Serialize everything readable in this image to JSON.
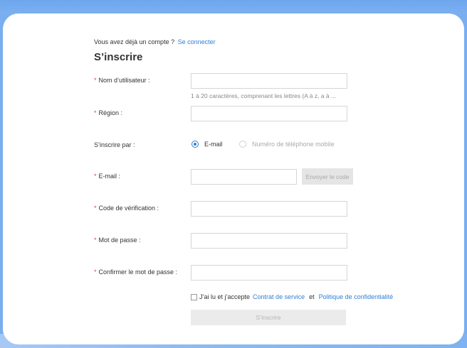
{
  "header": {
    "have_account_text": "Vous avez déjà un compte ?",
    "login_link": "Se connecter",
    "title": "S’inscrire"
  },
  "form": {
    "required_mark": "*",
    "username": {
      "label": "Nom d’utilisateur :",
      "value": "",
      "hint": "1 à 20 caractères, comprenant les lettres (A à z, a à ..."
    },
    "region": {
      "label": "Région :",
      "value": ""
    },
    "register_via": {
      "label": "S’inscrire par :",
      "options": [
        {
          "label": "E-mail",
          "selected": true
        },
        {
          "label": "Numéro de téléphone mobile",
          "selected": false,
          "disabled": true
        }
      ]
    },
    "email": {
      "label": "E-mail :",
      "value": "",
      "send_code_label": "Envoyer le code"
    },
    "verification_code": {
      "label": "Code de vérification :",
      "value": ""
    },
    "password": {
      "label": "Mot de passe :",
      "value": ""
    },
    "confirm_password": {
      "label": "Confirmer le mot de passe :",
      "value": ""
    },
    "agreement": {
      "checked": false,
      "prefix": "J’ai lu et j’accepte",
      "service_link": "Contrat de service",
      "and": "et",
      "privacy_link": "Politique de confidentialité"
    },
    "submit_label": "S’inscrire"
  },
  "colors": {
    "accent": "#2f7fd6",
    "required": "#e0484a",
    "background": "#79aef0"
  }
}
